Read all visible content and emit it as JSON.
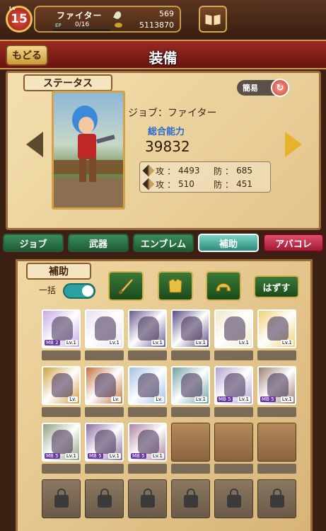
{
  "header": {
    "level_label": "Lv",
    "level": "15",
    "player_name": "ファイター",
    "ep_label": "EP",
    "ep_value": "0/16",
    "ep_progress": 0,
    "gems": "569",
    "gold": "5113870"
  },
  "titlebar": {
    "back_label": "もどる",
    "title": "装備"
  },
  "status": {
    "section_label": "ステータス",
    "simple_label": "簡易",
    "job_text": "ジョブ：ファイター",
    "power_label": "総合能力",
    "power_value": "39832",
    "stats": [
      {
        "atk_label": "攻",
        "atk": "4493",
        "def_label": "防",
        "def": "685"
      },
      {
        "atk_label": "攻",
        "atk": "510",
        "def_label": "防",
        "def": "451"
      }
    ]
  },
  "tabs": [
    {
      "label": "ジョブ",
      "active": false
    },
    {
      "label": "武器",
      "active": false
    },
    {
      "label": "エンブレム",
      "active": false
    },
    {
      "label": "補助",
      "active": true
    },
    {
      "label": "アバコレ",
      "active": false
    }
  ],
  "assist": {
    "section_label": "補助",
    "bulk_label": "一括",
    "bulk_on": true,
    "remove_label": "はずす",
    "filters": [
      "sword-icon",
      "armor-icon",
      "helmet-icon"
    ]
  },
  "cards": [
    {
      "mb": "MB 2",
      "lv": "Lv.1",
      "color": "#c8a8e8"
    },
    {
      "mb": "",
      "lv": "Lv.1",
      "color": "#e8e0f0"
    },
    {
      "mb": "",
      "lv": "Lv.1",
      "color": "#6a5a90"
    },
    {
      "mb": "",
      "lv": "Lv.1",
      "color": "#5a4a80"
    },
    {
      "mb": "",
      "lv": "Lv.1",
      "color": "#f0e8c8"
    },
    {
      "mb": "",
      "lv": "Lv.1",
      "color": "#f0d070"
    },
    {
      "mb": "",
      "lv": "Lv.",
      "color": "#d0a040"
    },
    {
      "mb": "",
      "lv": "Lv.",
      "color": "#c07040"
    },
    {
      "mb": "",
      "lv": "Lv.",
      "color": "#a0c0e0"
    },
    {
      "mb": "",
      "lv": "Lv.1",
      "color": "#70a0a0"
    },
    {
      "mb": "MB 5",
      "lv": "Lv.1",
      "color": "#b0a0d0"
    },
    {
      "mb": "MB 5",
      "lv": "Lv.1",
      "color": "#a08070"
    },
    {
      "mb": "MB 5",
      "lv": "Lv.1",
      "color": "#90a080"
    },
    {
      "mb": "MB 5",
      "lv": "Lv.1",
      "color": "#8a6aa0"
    },
    {
      "mb": "MB 5",
      "lv": "Lv.1",
      "color": "#b080a0"
    }
  ]
}
